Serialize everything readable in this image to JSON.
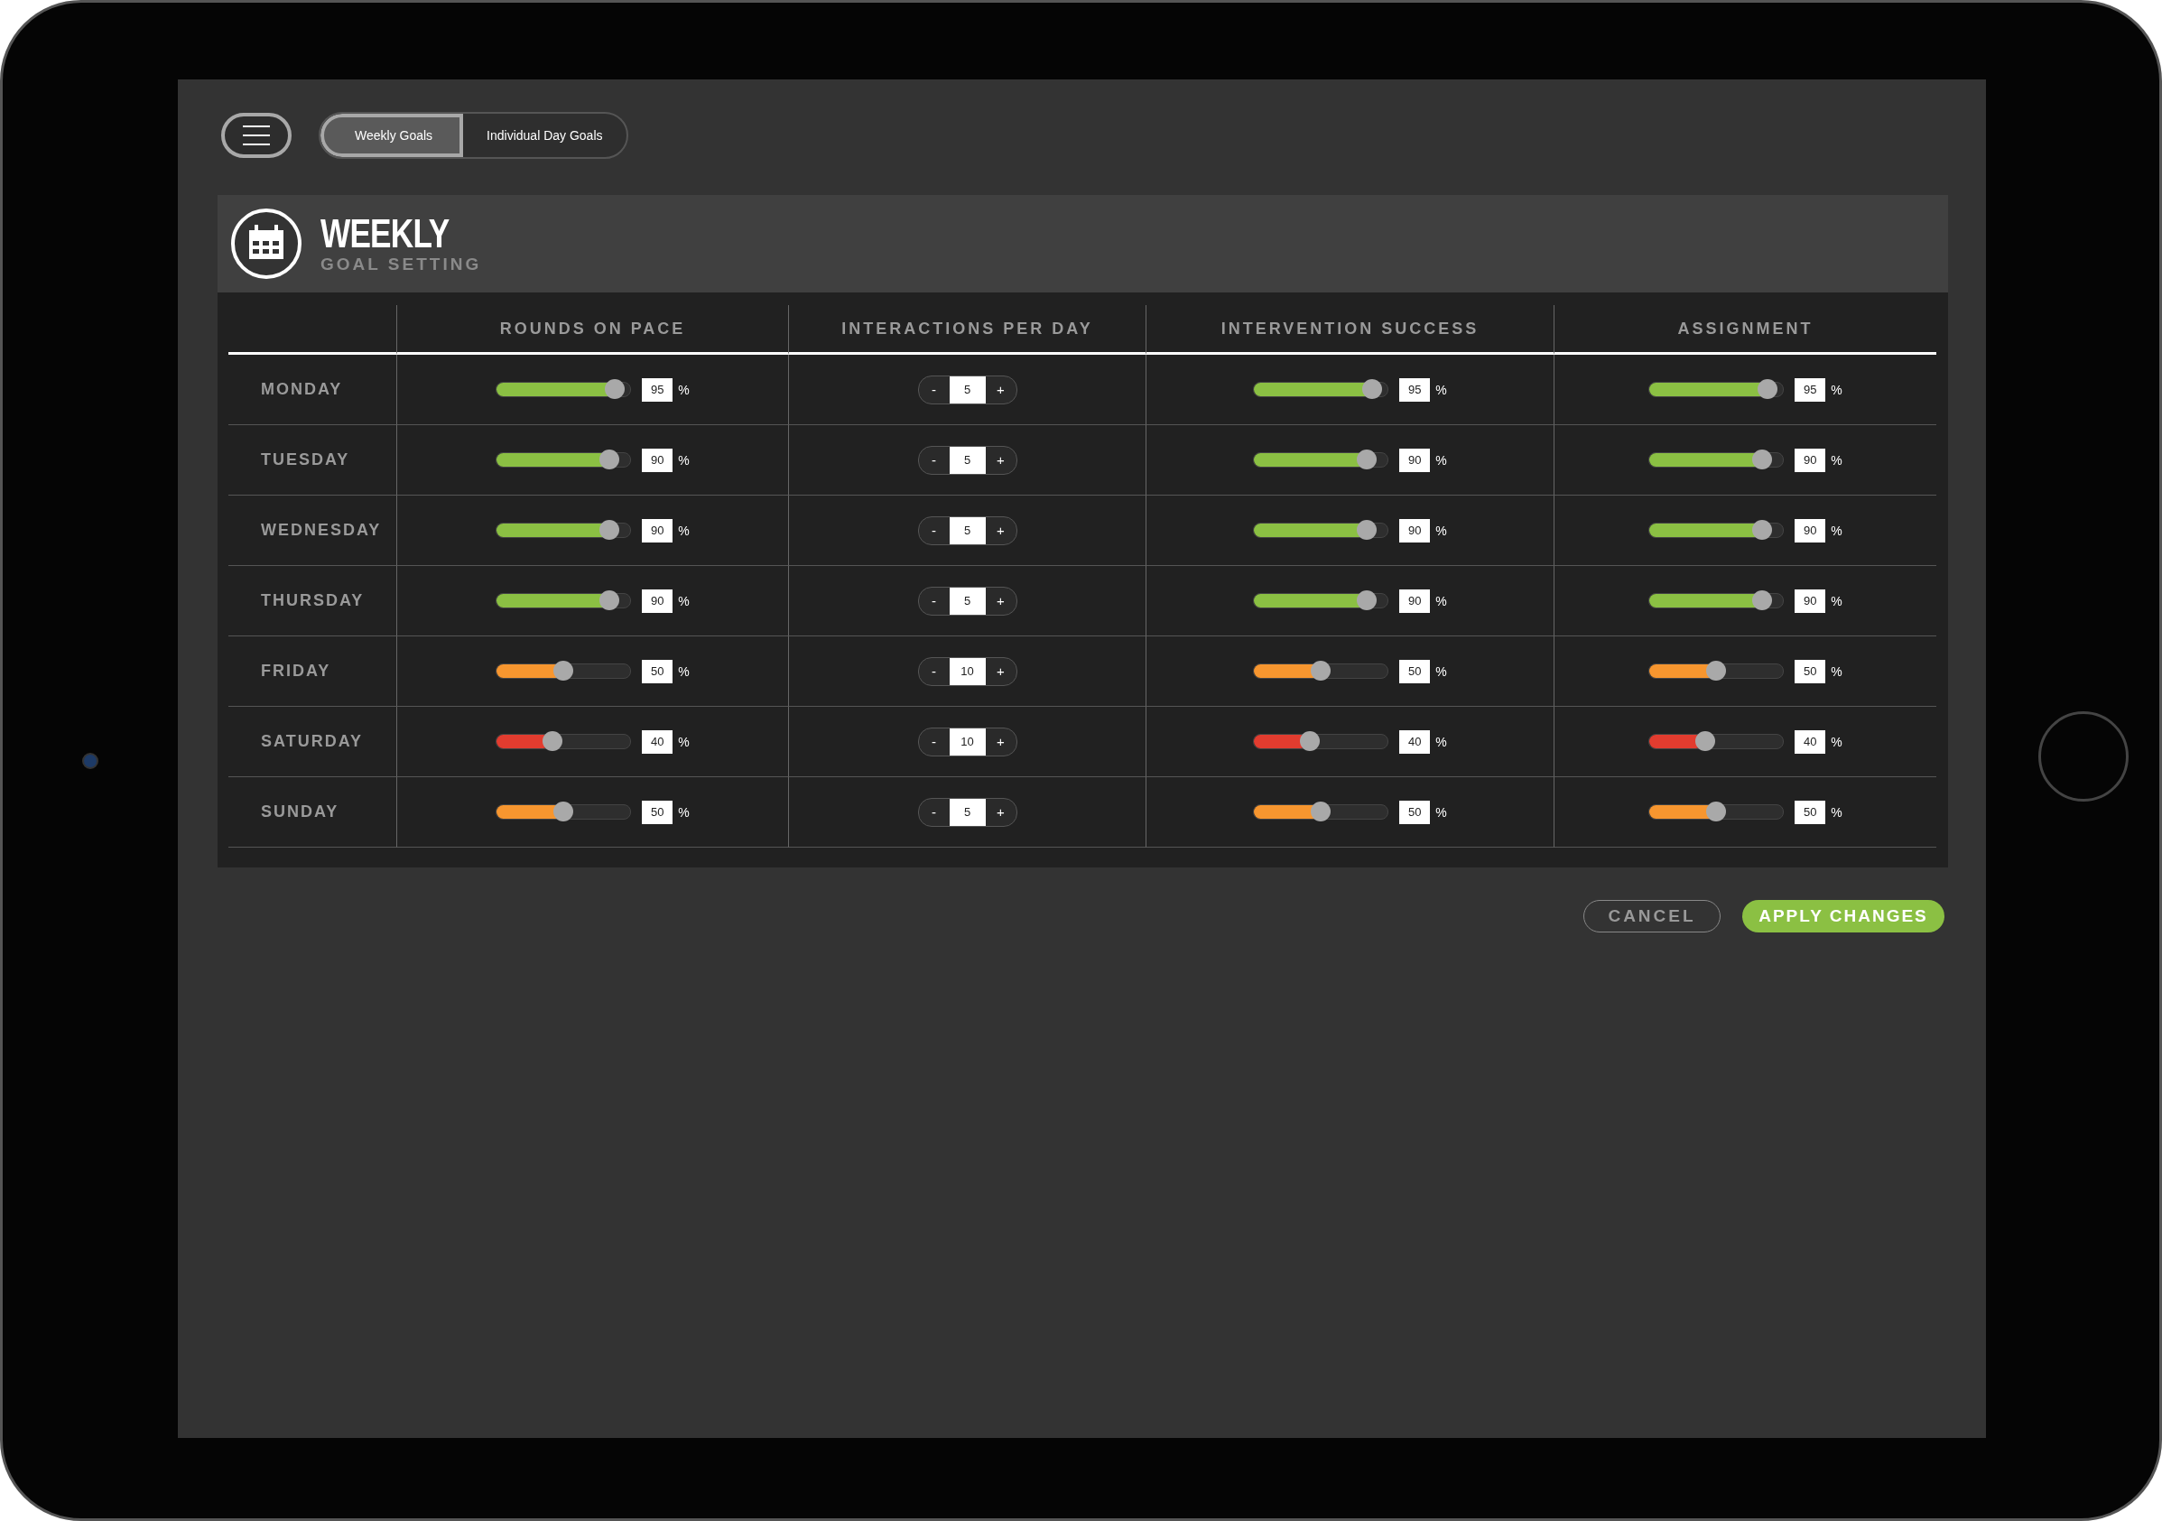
{
  "toolbar": {
    "tabs": [
      {
        "label": "Weekly Goals",
        "selected": true
      },
      {
        "label": "Individual Day Goals",
        "selected": false
      }
    ]
  },
  "header": {
    "title": "WEEKLY",
    "subtitle": "GOAL SETTING"
  },
  "table": {
    "columns": [
      "ROUNDS ON PACE",
      "INTERACTIONS PER DAY",
      "INTERVENTION SUCCESS",
      "ASSIGNMENT"
    ],
    "rows": [
      {
        "day": "MONDAY",
        "cells": [
          {
            "kind": "slider",
            "level": 0.95,
            "value": "95",
            "unit": "%"
          },
          {
            "kind": "stepper",
            "minus": "-",
            "value": "5",
            "plus": "+"
          },
          {
            "kind": "slider",
            "level": 0.95,
            "value": "95",
            "unit": "%"
          },
          {
            "kind": "slider",
            "level": 0.95,
            "value": "95",
            "unit": "%"
          }
        ]
      },
      {
        "day": "TUESDAY",
        "cells": [
          {
            "kind": "slider",
            "level": 0.9,
            "value": "90",
            "unit": "%"
          },
          {
            "kind": "stepper",
            "minus": "-",
            "value": "5",
            "plus": "+"
          },
          {
            "kind": "slider",
            "level": 0.9,
            "value": "90",
            "unit": "%"
          },
          {
            "kind": "slider",
            "level": 0.9,
            "value": "90",
            "unit": "%"
          }
        ]
      },
      {
        "day": "WEDNESDAY",
        "cells": [
          {
            "kind": "slider",
            "level": 0.9,
            "value": "90",
            "unit": "%"
          },
          {
            "kind": "stepper",
            "minus": "-",
            "value": "5",
            "plus": "+"
          },
          {
            "kind": "slider",
            "level": 0.9,
            "value": "90",
            "unit": "%"
          },
          {
            "kind": "slider",
            "level": 0.9,
            "value": "90",
            "unit": "%"
          }
        ]
      },
      {
        "day": "THURSDAY",
        "cells": [
          {
            "kind": "slider",
            "level": 0.9,
            "value": "90",
            "unit": "%"
          },
          {
            "kind": "stepper",
            "minus": "-",
            "value": "5",
            "plus": "+"
          },
          {
            "kind": "slider",
            "level": 0.9,
            "value": "90",
            "unit": "%"
          },
          {
            "kind": "slider",
            "level": 0.9,
            "value": "90",
            "unit": "%"
          }
        ]
      },
      {
        "day": "FRIDAY",
        "cells": [
          {
            "kind": "slider",
            "level": 0.5,
            "value": "50",
            "unit": "%"
          },
          {
            "kind": "stepper",
            "minus": "-",
            "value": "10",
            "plus": "+"
          },
          {
            "kind": "slider",
            "level": 0.5,
            "value": "50",
            "unit": "%"
          },
          {
            "kind": "slider",
            "level": 0.5,
            "value": "50",
            "unit": "%"
          }
        ]
      },
      {
        "day": "SATURDAY",
        "cells": [
          {
            "kind": "slider",
            "level": 0.4,
            "value": "40",
            "unit": "%"
          },
          {
            "kind": "stepper",
            "minus": "-",
            "value": "10",
            "plus": "+"
          },
          {
            "kind": "slider",
            "level": 0.4,
            "value": "40",
            "unit": "%"
          },
          {
            "kind": "slider",
            "level": 0.4,
            "value": "40",
            "unit": "%"
          }
        ]
      },
      {
        "day": "SUNDAY",
        "cells": [
          {
            "kind": "slider",
            "level": 0.5,
            "value": "50",
            "unit": "%"
          },
          {
            "kind": "stepper",
            "minus": "-",
            "value": "5",
            "plus": "+"
          },
          {
            "kind": "slider",
            "level": 0.5,
            "value": "50",
            "unit": "%"
          },
          {
            "kind": "slider",
            "level": 0.5,
            "value": "50",
            "unit": "%"
          }
        ]
      }
    ]
  },
  "actions": {
    "cancel": "CANCEL",
    "apply": "APPLY CHANGES"
  }
}
